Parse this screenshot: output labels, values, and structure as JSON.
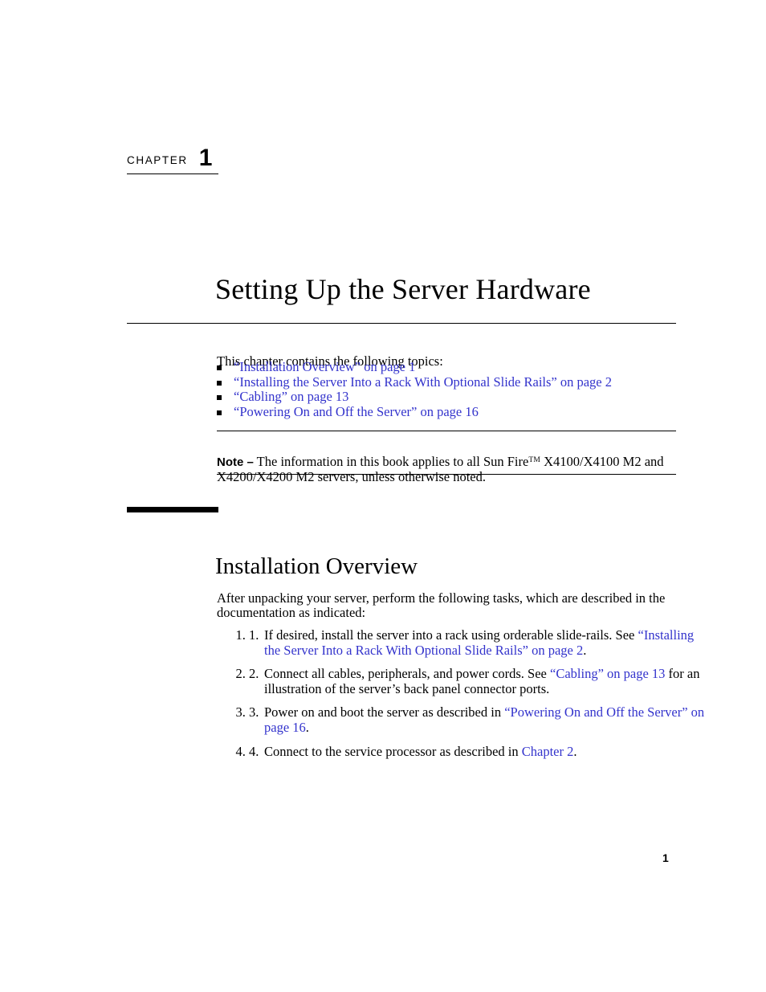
{
  "document": {
    "chapter_label": "CHAPTER",
    "chapter_number": "1",
    "chapter_title": "Setting Up the Server Hardware",
    "page_number": "1"
  },
  "intro": {
    "lead_in": "This chapter contains the following topics:",
    "topics": [
      {
        "text": "“Installation Overview” on page 1"
      },
      {
        "text": "“Installing the Server Into a Rack With Optional Slide Rails” on page 2"
      },
      {
        "text": "“Cabling” on page 13"
      },
      {
        "text": "“Powering On and Off the Server” on page 16"
      }
    ]
  },
  "note": {
    "label": "Note –",
    "text_before_tm": " The information in this book applies to all Sun Fire",
    "tm": "TM",
    "text_after_tm": " X4100/X4100 M2 and X4200/X4200 M2 servers, unless otherwise noted."
  },
  "section": {
    "heading": "Installation Overview",
    "intro": "After unpacking your server, perform the following tasks, which are described in the documentation as indicated:",
    "steps": [
      {
        "number": "1.",
        "part1": "If desired, install the server into a rack using orderable slide-rails. See ",
        "link": "“Installing the Server Into a Rack With Optional Slide Rails” on page 2",
        "part2": "."
      },
      {
        "number": "2.",
        "part1": "Connect all cables, peripherals, and power cords. See ",
        "link": "“Cabling” on page 13",
        "part2": " for an illustration of the server’s back panel connector ports."
      },
      {
        "number": "3.",
        "part1": "Power on and boot the server as described in ",
        "link": "“Powering On and Off the Server” on page 16",
        "part2": "."
      },
      {
        "number": "4.",
        "part1": "Connect to the service processor as described in ",
        "link": "Chapter 2",
        "part2": "."
      }
    ]
  },
  "colors": {
    "link": "#3333cc",
    "text": "#000000",
    "page_background": "#ffffff"
  }
}
